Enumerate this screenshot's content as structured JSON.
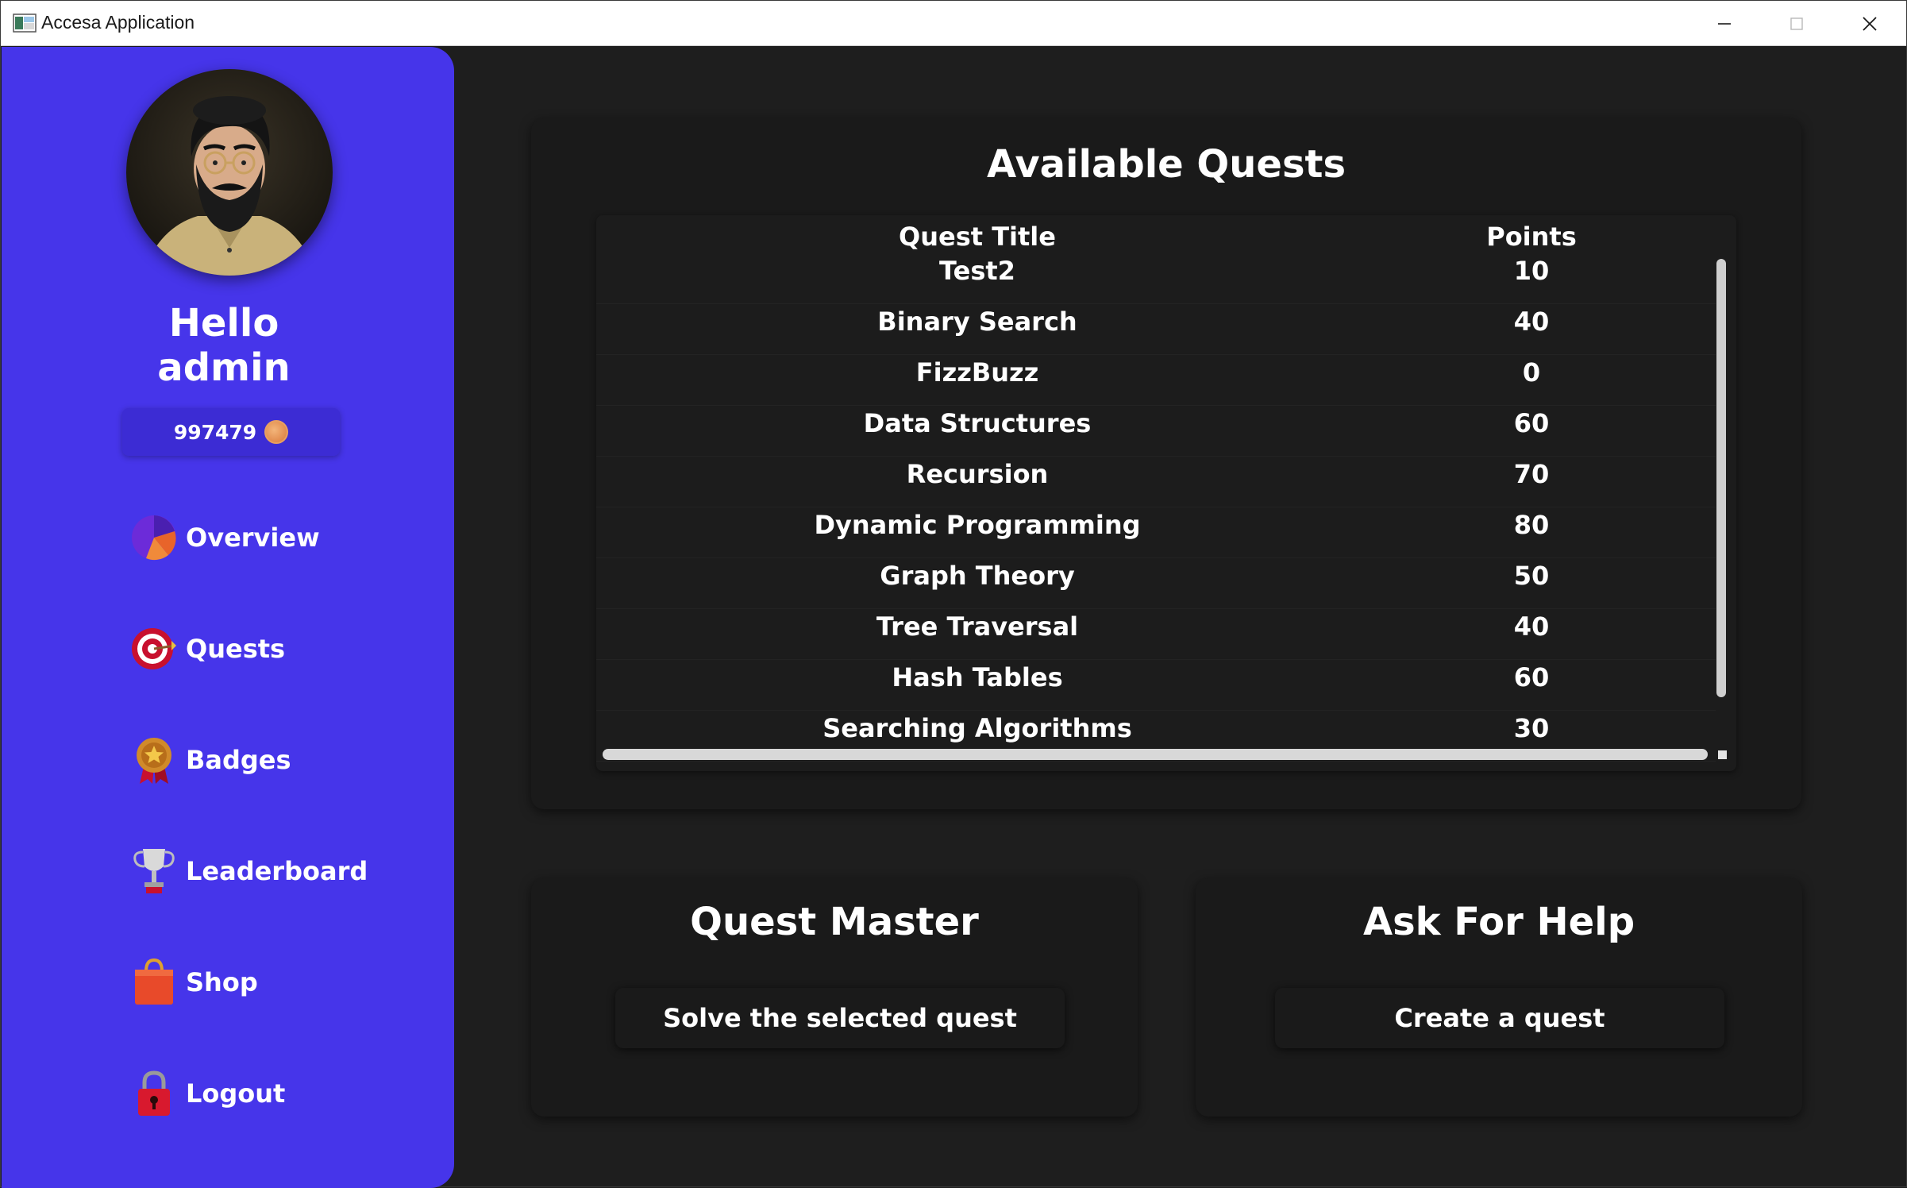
{
  "window": {
    "title": "Accesa Application"
  },
  "sidebar": {
    "greeting_line1": "Hello",
    "greeting_line2": "admin",
    "coins": "997479",
    "nav": [
      {
        "label": "Overview",
        "icon": "pie-chart-icon"
      },
      {
        "label": "Quests",
        "icon": "target-icon"
      },
      {
        "label": "Badges",
        "icon": "medal-icon"
      },
      {
        "label": "Leaderboard",
        "icon": "trophy-icon"
      },
      {
        "label": "Shop",
        "icon": "shopping-bag-icon"
      },
      {
        "label": "Logout",
        "icon": "lock-icon"
      }
    ],
    "background_color": "#4635ea"
  },
  "quests": {
    "title": "Available Quests",
    "columns": [
      "Quest Title",
      "Points"
    ],
    "rows": [
      {
        "title": "Test2",
        "points": "10"
      },
      {
        "title": "Binary Search",
        "points": "40"
      },
      {
        "title": "FizzBuzz",
        "points": "0"
      },
      {
        "title": "Data Structures",
        "points": "60"
      },
      {
        "title": "Recursion",
        "points": "70"
      },
      {
        "title": "Dynamic Programming",
        "points": "80"
      },
      {
        "title": "Graph Theory",
        "points": "50"
      },
      {
        "title": "Tree Traversal",
        "points": "40"
      },
      {
        "title": "Hash Tables",
        "points": "60"
      },
      {
        "title": "Searching Algorithms",
        "points": "30"
      }
    ]
  },
  "quest_master": {
    "title": "Quest Master",
    "button": "Solve the selected quest"
  },
  "ask_help": {
    "title": "Ask For Help",
    "button": "Create a quest"
  }
}
